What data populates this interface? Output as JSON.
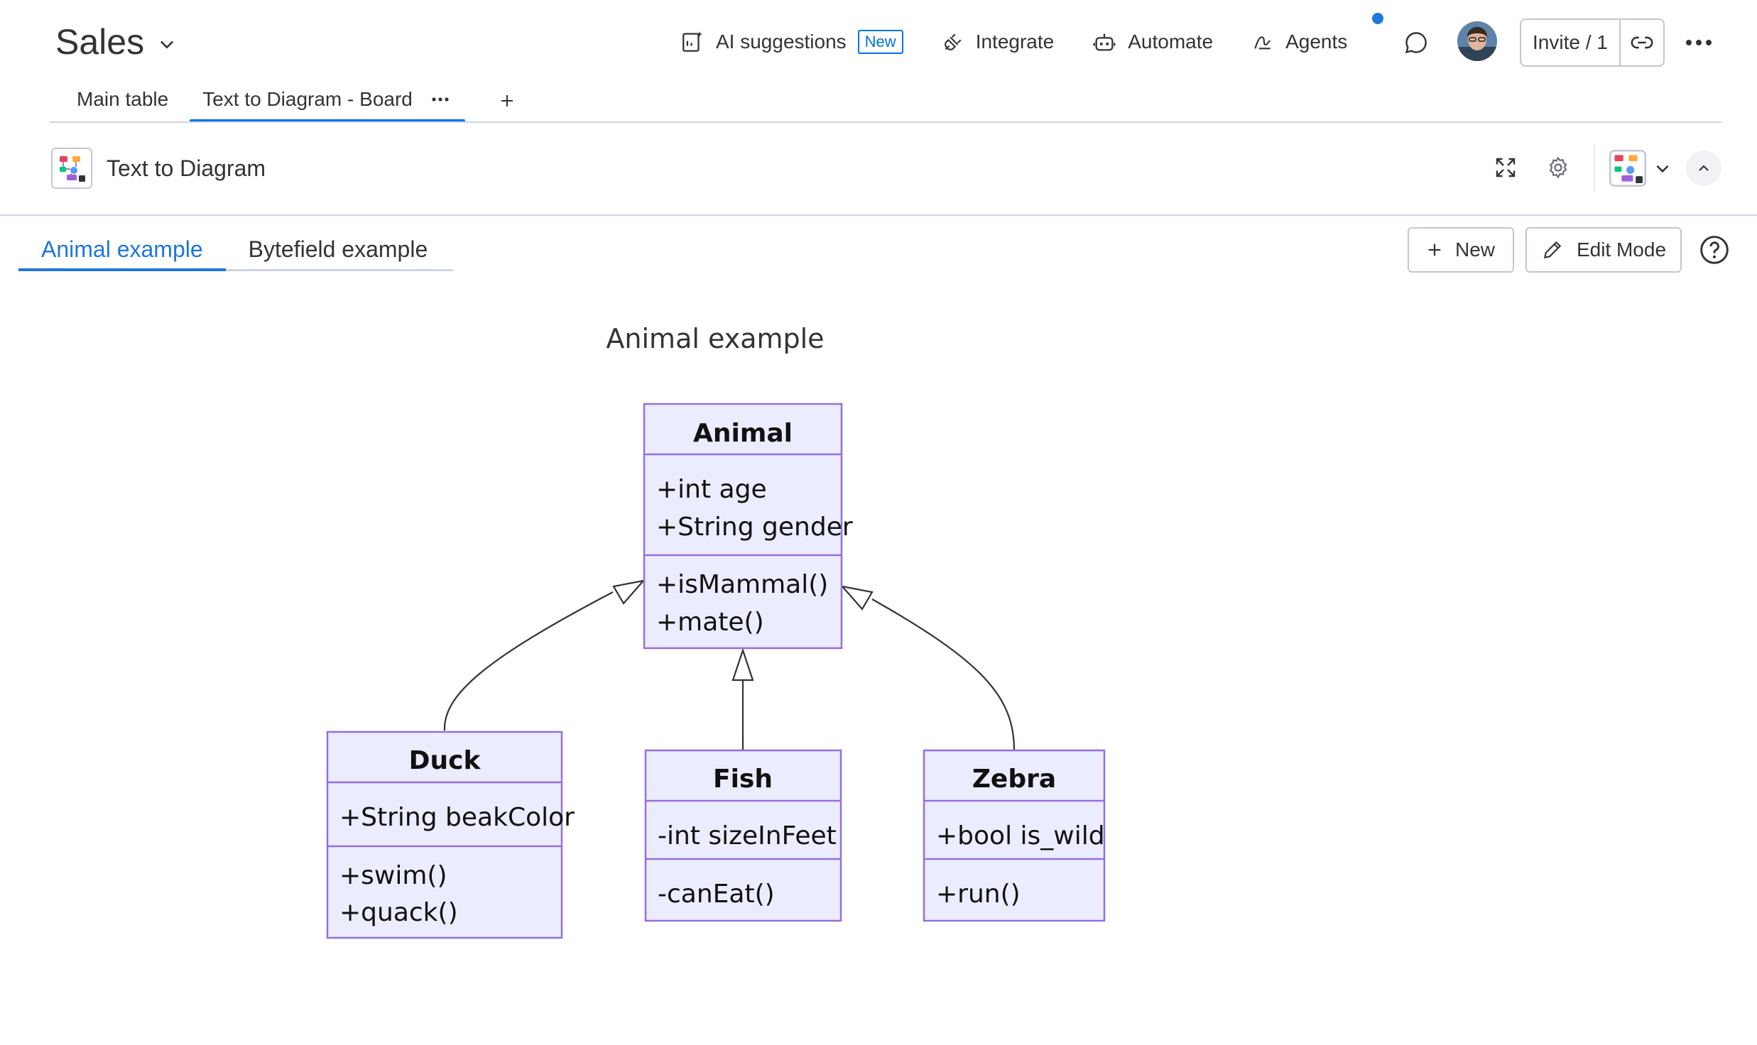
{
  "header": {
    "board_title": "Sales",
    "ai_suggestions_label": "AI suggestions",
    "new_badge": "New",
    "integrate_label": "Integrate",
    "automate_label": "Automate",
    "agents_label": "Agents",
    "invite_label": "Invite / 1"
  },
  "view_tabs": [
    {
      "label": "Main table"
    },
    {
      "label": "Text to Diagram - Board",
      "active": true
    }
  ],
  "widget": {
    "title": "Text to Diagram"
  },
  "diagram_tabs": [
    {
      "label": "Animal example",
      "active": true
    },
    {
      "label": "Bytefield example"
    }
  ],
  "toolbar": {
    "new_label": "New",
    "edit_mode_label": "Edit Mode"
  },
  "diagram": {
    "title": "Animal example",
    "classes": {
      "animal": {
        "name": "Animal",
        "attributes": [
          "+int age",
          "+String gender"
        ],
        "methods": [
          "+isMammal()",
          "+mate()"
        ]
      },
      "duck": {
        "name": "Duck",
        "attributes": [
          "+String beakColor"
        ],
        "methods": [
          "+swim()",
          "+quack()"
        ]
      },
      "fish": {
        "name": "Fish",
        "attributes": [
          "-int sizeInFeet"
        ],
        "methods": [
          "-canEat()"
        ]
      },
      "zebra": {
        "name": "Zebra",
        "attributes": [
          "+bool is_wild"
        ],
        "methods": [
          "+run()"
        ]
      }
    },
    "relations": [
      "Duck inherits Animal",
      "Fish inherits Animal",
      "Zebra inherits Animal"
    ]
  },
  "colors": {
    "accent": "#0073ea",
    "class_fill": "#ececff",
    "class_border": "#9370db",
    "notification_dot": "#1f76db"
  }
}
